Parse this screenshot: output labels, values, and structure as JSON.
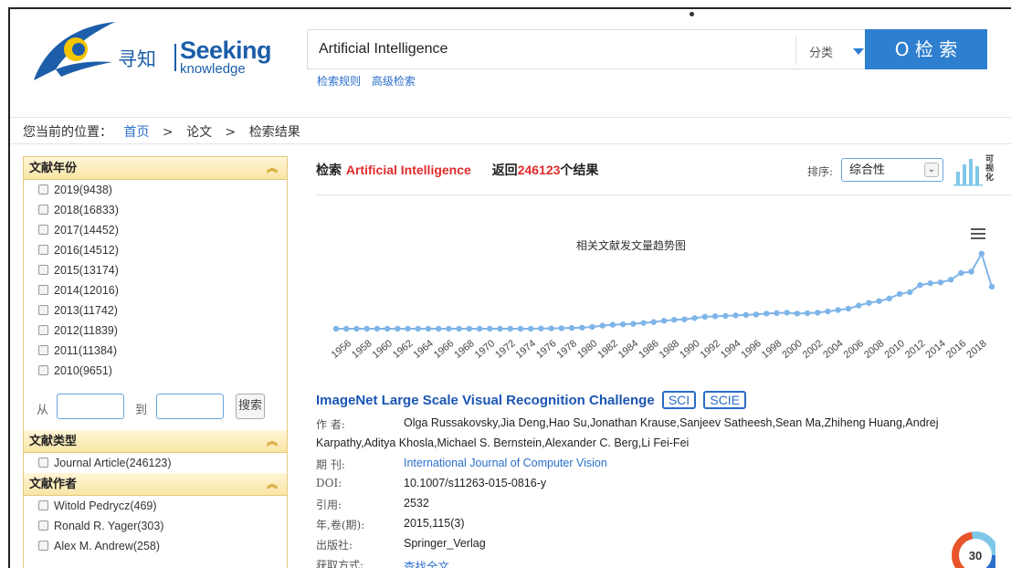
{
  "logo": {
    "cn": "寻知",
    "en": "Seeking",
    "en2": "knowledge"
  },
  "search": {
    "query": "Artificial Intelligence",
    "category_label": "分类",
    "button_label": "O 检 索",
    "links": [
      "检索规则",
      "高级检索"
    ]
  },
  "breadcrumb": {
    "prefix": "您当前的位置：",
    "items": [
      "首页",
      "论文",
      "检索结果"
    ],
    "sep": ">"
  },
  "sidebar": {
    "year_title": "文献年份",
    "years": [
      "2019(9438)",
      "2018(16833)",
      "2017(14452)",
      "2016(14512)",
      "2015(13174)",
      "2014(12016)",
      "2013(11742)",
      "2012(11839)",
      "2011(11384)",
      "2010(9651)"
    ],
    "range_from": "从",
    "range_to": "到",
    "range_button": "搜索",
    "type_title": "文献类型",
    "types": [
      "Journal Article(246123)"
    ],
    "author_title": "文献作者",
    "authors": [
      "Witold Pedrycz(469)",
      "Ronald R. Yager(303)",
      "Alex M. Andrew(258)"
    ]
  },
  "results": {
    "prefix": "检索",
    "query": "Artificial Intelligence",
    "return_prefix": "返回",
    "count": "246123",
    "suffix": "个结果",
    "sort_label": "排序:",
    "sort_value": "综合性",
    "viz_label": "可视化"
  },
  "chart_data": {
    "type": "line",
    "title": "相关文献发文量趋势图",
    "x": [
      1955,
      1956,
      1957,
      1958,
      1959,
      1960,
      1961,
      1962,
      1963,
      1964,
      1965,
      1966,
      1967,
      1968,
      1969,
      1970,
      1971,
      1972,
      1973,
      1974,
      1975,
      1976,
      1977,
      1978,
      1979,
      1980,
      1981,
      1982,
      1983,
      1984,
      1985,
      1986,
      1987,
      1988,
      1989,
      1990,
      1991,
      1992,
      1993,
      1994,
      1995,
      1996,
      1997,
      1998,
      1999,
      2000,
      2001,
      2002,
      2003,
      2004,
      2005,
      2006,
      2007,
      2008,
      2009,
      2010,
      2011,
      2012,
      2013,
      2014,
      2015,
      2016,
      2017,
      2018,
      2019
    ],
    "xticks": [
      "1956",
      "1958",
      "1960",
      "1962",
      "1964",
      "1966",
      "1968",
      "1970",
      "1972",
      "1974",
      "1976",
      "1978",
      "1980",
      "1982",
      "1984",
      "1986",
      "1988",
      "1990",
      "1992",
      "1994",
      "1996",
      "1998",
      "2000",
      "2002",
      "2004",
      "2006",
      "2008",
      "2010",
      "2012",
      "2014",
      "2016",
      "2018"
    ],
    "values": [
      0,
      0,
      0,
      0,
      0,
      0,
      0,
      0,
      0,
      0,
      0,
      0,
      0,
      0,
      0,
      0,
      0,
      0,
      0,
      0,
      50,
      80,
      120,
      180,
      250,
      400,
      700,
      900,
      1000,
      1100,
      1300,
      1500,
      1800,
      2000,
      2100,
      2400,
      2700,
      2800,
      2900,
      3000,
      3100,
      3200,
      3400,
      3500,
      3600,
      3400,
      3500,
      3600,
      3900,
      4200,
      4500,
      5200,
      5800,
      6200,
      6800,
      7800,
      8200,
      9800,
      10200,
      10400,
      11000,
      12500,
      12800,
      16833,
      9438
    ],
    "ylim": [
      0,
      17000
    ]
  },
  "article": {
    "title": "ImageNet Large Scale Visual Recognition Challenge",
    "badges": [
      "SCI",
      "SCIE"
    ],
    "author_label": "作 者:",
    "authors_line1": "Olga Russakovsky,Jia Deng,Hao Su,Jonathan Krause,Sanjeev Satheesh,Sean Ma,Zhiheng Huang,Andrej",
    "authors_line2": "Karpathy,Aditya Khosla,Michael S. Bernstein,Alexander C. Berg,Li Fei-Fei",
    "journal_label": "期 刊:",
    "journal": "International Journal of Computer Vision",
    "doi_label": "DOI:",
    "doi": "10.1007/s11263-015-0816-y",
    "cite_label": "引用:",
    "cite": "2532",
    "year_label": "年,卷(期):",
    "year": "2015,115(3)",
    "publisher_label": "出版社:",
    "publisher": "Springer_Verlag",
    "access_label": "获取方式:",
    "access": "查找全文",
    "altmetric": "30"
  },
  "colors": {
    "accent": "#2e7fcf",
    "line": "#7fb5e8",
    "red": "#e02b2b",
    "sidebar_head": "#f9e5a6"
  }
}
